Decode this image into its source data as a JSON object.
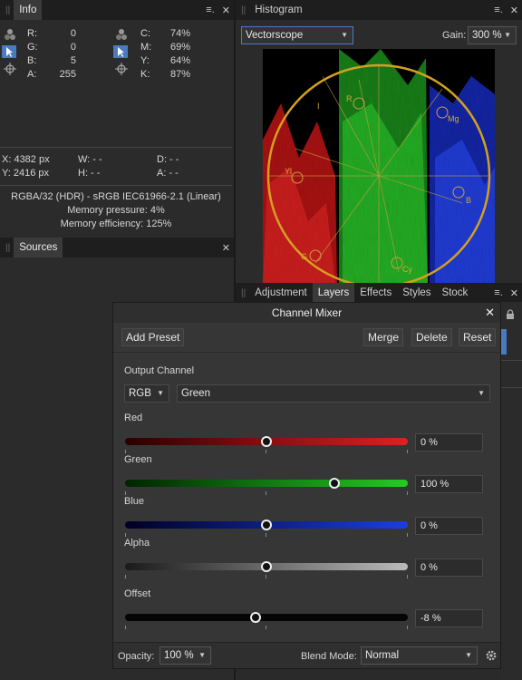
{
  "info_panel": {
    "tab": "Info",
    "rgb": [
      {
        "k": "R:",
        "v": "0"
      },
      {
        "k": "G:",
        "v": "0"
      },
      {
        "k": "B:",
        "v": "5"
      },
      {
        "k": "A:",
        "v": "255"
      }
    ],
    "cmyk": [
      {
        "k": "C:",
        "v": "74%"
      },
      {
        "k": "M:",
        "v": "69%"
      },
      {
        "k": "Y:",
        "v": "64%"
      },
      {
        "k": "K:",
        "v": "87%"
      }
    ],
    "x": "X: 4382 px",
    "y": "Y: 2416 px",
    "w": "W: - -",
    "h": "H: - -",
    "d": "D: - -",
    "a": "A: - -",
    "format": "RGBA/32 (HDR) - sRGB IEC61966-2.1 (Linear)",
    "memory_pressure": "Memory pressure: 4%",
    "memory_efficiency": "Memory efficiency: 125%"
  },
  "histogram_panel": {
    "tab": "Histogram",
    "mode": "Vectorscope",
    "gain_label": "Gain:",
    "gain_value": "300 %",
    "scope_labels": [
      "R",
      "Mg",
      "Yl",
      "B",
      "G",
      "Cy",
      "I"
    ]
  },
  "sources_panel": {
    "tab": "Sources"
  },
  "layers_tabs": [
    "Adjustment",
    "Layers",
    "Effects",
    "Styles",
    "Stock"
  ],
  "channel_mixer": {
    "title": "Channel Mixer",
    "add_preset": "Add Preset",
    "merge": "Merge",
    "delete": "Delete",
    "reset": "Reset",
    "output_channel_label": "Output Channel",
    "color_model": "RGB",
    "channel": "Green",
    "sliders": [
      {
        "label": "Red",
        "value": "0 %",
        "fraction": 0.5
      },
      {
        "label": "Green",
        "value": "100 %",
        "fraction": 0.74
      },
      {
        "label": "Blue",
        "value": "0 %",
        "fraction": 0.5
      },
      {
        "label": "Alpha",
        "value": "0 %",
        "fraction": 0.5
      },
      {
        "label": "Offset",
        "value": "-8 %",
        "fraction": 0.46
      }
    ],
    "opacity_label": "Opacity:",
    "opacity_value": "100 %",
    "blend_mode_label": "Blend Mode:",
    "blend_mode_value": "Normal"
  },
  "colors": {
    "red_slider": "#e02020",
    "green_slider": "#22cc22",
    "blue_slider": "#1a3fe0",
    "alpha_slider": "#bbbbbb",
    "accent_select": "#4a7bc0"
  }
}
